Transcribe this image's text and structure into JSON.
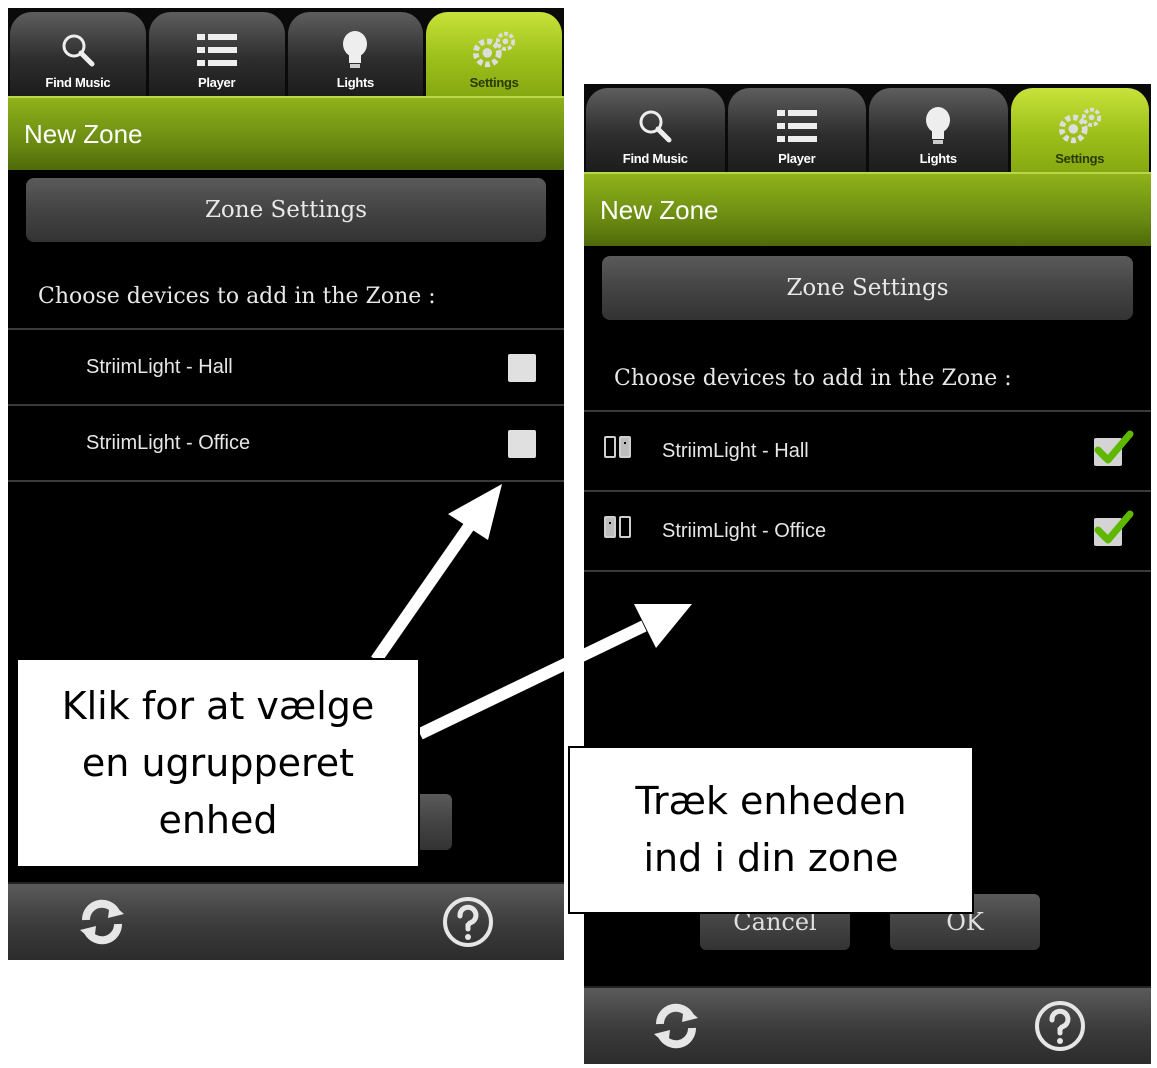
{
  "tabs": [
    {
      "label": "Find Music",
      "icon": "search-icon"
    },
    {
      "label": "Player",
      "icon": "list-icon"
    },
    {
      "label": "Lights",
      "icon": "lightbulb-icon"
    },
    {
      "label": "Settings",
      "icon": "gears-icon",
      "active": true
    }
  ],
  "left": {
    "title": "New Zone",
    "zone_settings_label": "Zone Settings",
    "choose_label": "Choose devices to add in the Zone :",
    "devices": [
      {
        "label": "StriimLight - Hall",
        "checked": false
      },
      {
        "label": "StriimLight - Office",
        "checked": false
      }
    ]
  },
  "right": {
    "title": "New Zone",
    "zone_settings_label": "Zone Settings",
    "choose_label": "Choose devices to add in the Zone :",
    "devices": [
      {
        "label": "StriimLight - Hall",
        "checked": true
      },
      {
        "label": "StriimLight - Office",
        "checked": true
      }
    ],
    "cancel_label": "Cancel",
    "ok_label": "OK"
  },
  "callouts": {
    "left": "Klik for at vælge\nen ugrupperet\nenhed",
    "right": "Træk enheden\nind i din zone"
  },
  "colors": {
    "accent_green": "#9cc01a",
    "checkmark_green": "#5fb800"
  }
}
